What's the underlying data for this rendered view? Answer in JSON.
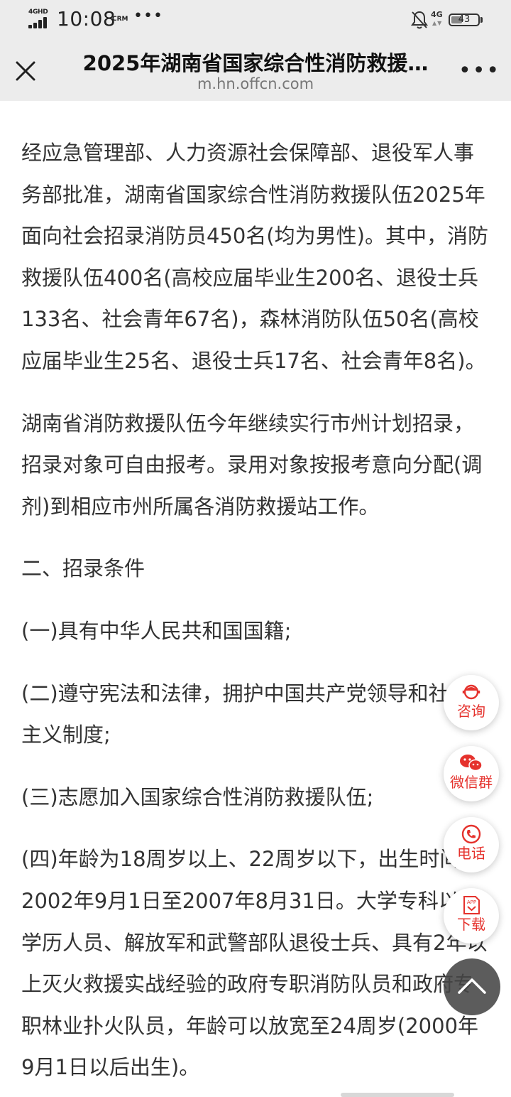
{
  "status_bar": {
    "network_label": "4GHD",
    "time": "10:08",
    "carrier": "CRM",
    "more": "•••",
    "secondary_network": "4G",
    "battery": "43",
    "battery_level": 0.43
  },
  "header": {
    "title": "2025年湖南省国家综合性消防救援…",
    "url": "m.hn.offcn.com",
    "close_icon": "close-icon",
    "more_icon": "more-horizontal-icon"
  },
  "article": {
    "paragraphs": [
      "经应急管理部、人力资源社会保障部、退役军人事务部批准，湖南省国家综合性消防救援队伍2025年面向社会招录消防员450名(均为男性)。其中，消防救援队伍400名(高校应届毕业生200名、退役士兵133名、社会青年67名)，森林消防队伍50名(高校应届毕业生25名、退役士兵17名、社会青年8名)。",
      "湖南省消防救援队伍今年继续实行市州计划招录，招录对象可自由报考。录用对象按报考意向分配(调剂)到相应市州所属各消防救援站工作。",
      "二、招录条件",
      "(一)具有中华人民共和国国籍;",
      "(二)遵守宪法和法律，拥护中国共产党领导和社会主义制度;",
      "(三)志愿加入国家综合性消防救援队伍;",
      "(四)年龄为18周岁以上、22周岁以下，出生时间为2002年9月1日至2007年8月31日。大学专科以上学历人员、解放军和武警部队退役士兵、具有2年以上灭火救援实战经验的政府专职消防队员和政府专职林业扑火队员，年龄可以放宽至24周岁(2000年9月1日以后出生)。"
    ]
  },
  "floating_actions": [
    {
      "label": "咨询",
      "icon": "consultant-icon"
    },
    {
      "label": "微信群",
      "icon": "wechat-icon"
    },
    {
      "label": "电话",
      "icon": "phone-icon"
    },
    {
      "label": "下载",
      "icon": "app-download-icon",
      "icon_text": "APP"
    }
  ],
  "back_to_top_icon": "chevron-up-icon",
  "colors": {
    "header_bg": "#ececec",
    "accent": "#e5322d",
    "text": "#333333"
  }
}
